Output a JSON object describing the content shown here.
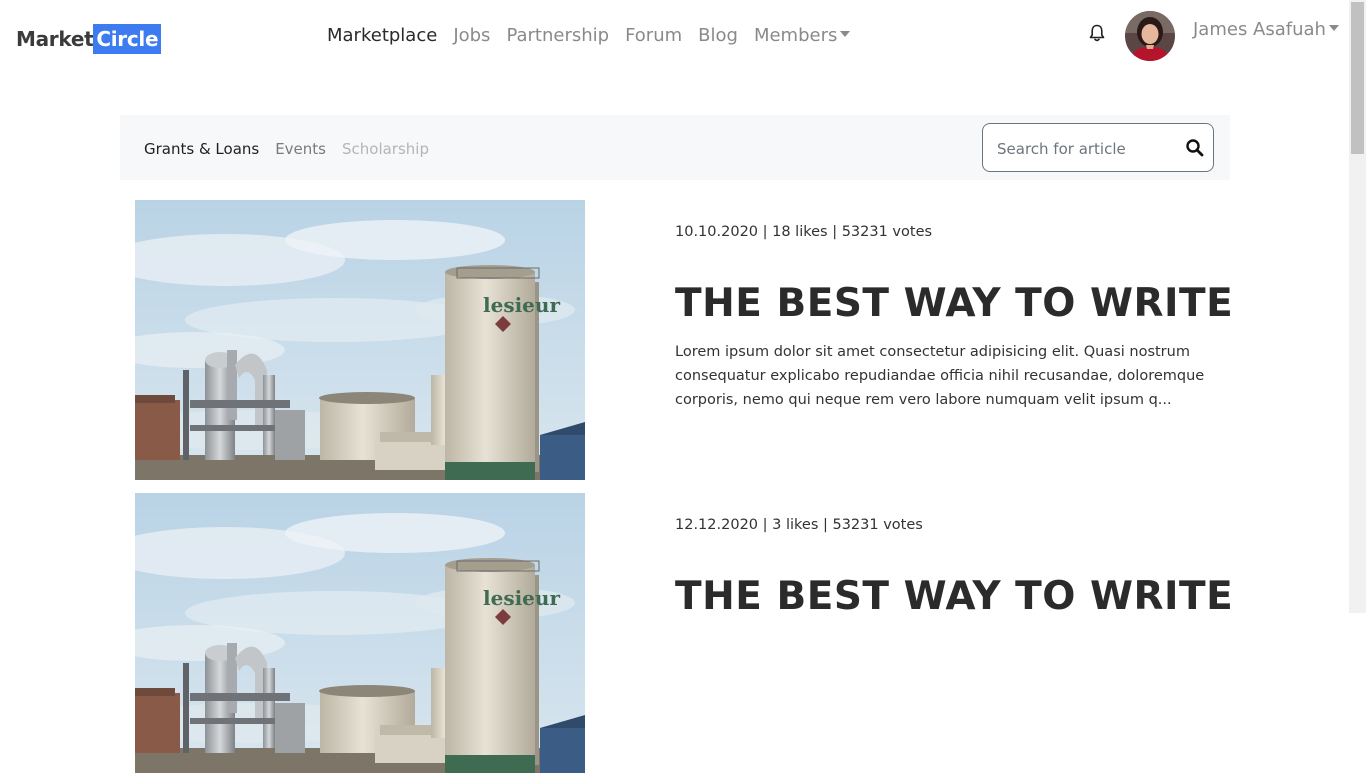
{
  "brand": {
    "part1": "Market",
    "part2": "Circle"
  },
  "nav": {
    "items": [
      {
        "label": "Marketplace",
        "active": true
      },
      {
        "label": "Jobs"
      },
      {
        "label": "Partnership"
      },
      {
        "label": "Forum"
      },
      {
        "label": "Blog"
      },
      {
        "label": "Members",
        "dropdown": true
      }
    ]
  },
  "user": {
    "name": "James Asafuah",
    "avatar": "profile-photo",
    "notification_icon": "bell-icon"
  },
  "subnav": {
    "links": [
      "Grants & Loans",
      "Events",
      "Scholarship"
    ],
    "search_placeholder": "Search for article",
    "search_icon": "search-icon"
  },
  "articles": [
    {
      "meta": "10.10.2020 | 18 likes | 53231 votes",
      "title": "THE BEST WAY TO WRITE",
      "excerpt": "Lorem ipsum dolor sit amet consectetur adipisicing elit. Quasi nostrum consequatur explicabo repudiandae officia nihil recusandae, doloremque corporis, nemo qui neque rem vero labore numquam velit ipsum q...",
      "image": "industrial-silos-photo",
      "silo_text": "lesieur"
    },
    {
      "meta": "12.12.2020 | 3 likes | 53231 votes",
      "title": "THE BEST WAY TO WRITE",
      "excerpt": "",
      "image": "industrial-silos-photo",
      "silo_text": "lesieur"
    }
  ],
  "colors": {
    "brand_blue": "#3c7bf0",
    "subnav_bg": "#f7f8f9",
    "text_dark": "#212529",
    "muted": "#8a8a8a"
  }
}
